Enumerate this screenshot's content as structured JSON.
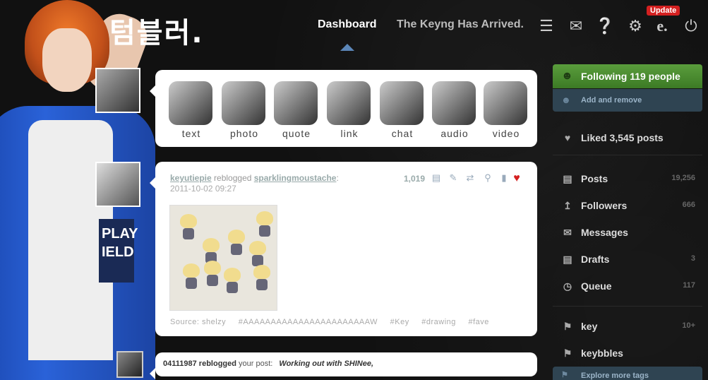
{
  "header": {
    "logo": "텀블러.",
    "nav_dashboard": "Dashboard",
    "nav_blog": "The Keyng Has Arrived.",
    "update_badge": "Update",
    "icons": [
      "list-icon",
      "mail-icon",
      "help-icon",
      "gear-icon",
      "e-icon",
      "power-icon"
    ]
  },
  "post_types": [
    {
      "label": "text"
    },
    {
      "label": "photo"
    },
    {
      "label": "quote"
    },
    {
      "label": "link"
    },
    {
      "label": "chat"
    },
    {
      "label": "audio"
    },
    {
      "label": "video"
    }
  ],
  "post1": {
    "user": "keyutiepie",
    "reblogged": " reblogged ",
    "source_user": "sparklingmoustache",
    "colon": ":",
    "date": "2011-10-02 09:27",
    "notes": "1,019",
    "source_line": "Source: shelzy",
    "tags": [
      "#AAAAAAAAAAAAAAAAAAAAAAAW",
      "#Key",
      "#drawing",
      "#fave"
    ]
  },
  "post2": {
    "user": "04111987",
    "reblogged_text": "reblogged",
    "your_post": "your post:",
    "title": "Working out with SHINee,"
  },
  "sidebar": {
    "following": "Following 119 people",
    "add_remove": "Add and remove",
    "liked": "Liked 3,545 posts",
    "posts": {
      "label": "Posts",
      "count": "19,256"
    },
    "followers": {
      "label": "Followers",
      "count": "666"
    },
    "messages": {
      "label": "Messages",
      "count": ""
    },
    "drafts": {
      "label": "Drafts",
      "count": "3"
    },
    "queue": {
      "label": "Queue",
      "count": "117"
    },
    "tag1": {
      "label": "key",
      "count": "10+"
    },
    "tag2": {
      "label": "keybbles",
      "count": ""
    },
    "explore": "Explore more tags"
  }
}
